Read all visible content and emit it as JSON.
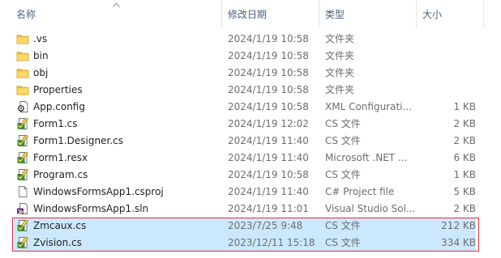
{
  "header": {
    "name_label": "名称",
    "date_label": "修改日期",
    "type_label": "类型",
    "size_label": "大小"
  },
  "files": [
    {
      "name": ".vs",
      "date": "2024/1/19 10:58",
      "type": "文件夹",
      "size": "",
      "icon": "folder-icon",
      "selected": false
    },
    {
      "name": "bin",
      "date": "2024/1/19 10:58",
      "type": "文件夹",
      "size": "",
      "icon": "folder-icon",
      "selected": false
    },
    {
      "name": "obj",
      "date": "2024/1/19 10:58",
      "type": "文件夹",
      "size": "",
      "icon": "folder-icon",
      "selected": false
    },
    {
      "name": "Properties",
      "date": "2024/1/19 10:58",
      "type": "文件夹",
      "size": "",
      "icon": "folder-icon",
      "selected": false
    },
    {
      "name": "App.config",
      "date": "2024/1/19 10:58",
      "type": "XML Configurati...",
      "size": "1 KB",
      "icon": "config-file-icon",
      "selected": false
    },
    {
      "name": "Form1.cs",
      "date": "2024/1/19 12:02",
      "type": "CS 文件",
      "size": "2 KB",
      "icon": "cs-file-icon",
      "selected": false
    },
    {
      "name": "Form1.Designer.cs",
      "date": "2024/1/19 11:40",
      "type": "CS 文件",
      "size": "2 KB",
      "icon": "cs-file-icon",
      "selected": false
    },
    {
      "name": "Form1.resx",
      "date": "2024/1/19 11:40",
      "type": "Microsoft .NET ...",
      "size": "6 KB",
      "icon": "resx-file-icon",
      "selected": false
    },
    {
      "name": "Program.cs",
      "date": "2024/1/19 10:58",
      "type": "CS 文件",
      "size": "1 KB",
      "icon": "cs-file-icon",
      "selected": false
    },
    {
      "name": "WindowsFormsApp1.csproj",
      "date": "2024/1/19 11:40",
      "type": "C# Project file",
      "size": "5 KB",
      "icon": "blank-file-icon",
      "selected": false
    },
    {
      "name": "WindowsFormsApp1.sln",
      "date": "2024/1/19 11:01",
      "type": "Visual Studio Sol...",
      "size": "2 KB",
      "icon": "sln-file-icon",
      "selected": false
    },
    {
      "name": "Zmcaux.cs",
      "date": "2023/7/25 9:48",
      "type": "CS 文件",
      "size": "212 KB",
      "icon": "cs-file-icon",
      "selected": true
    },
    {
      "name": "Zvision.cs",
      "date": "2023/12/11 15:18",
      "type": "CS 文件",
      "size": "334 KB",
      "icon": "cs-file-icon",
      "selected": true
    }
  ],
  "colors": {
    "selection": "#cce8ff",
    "highlight_border": "#e0303a",
    "folder": "#f4c64a",
    "header_text": "#4c607a"
  }
}
